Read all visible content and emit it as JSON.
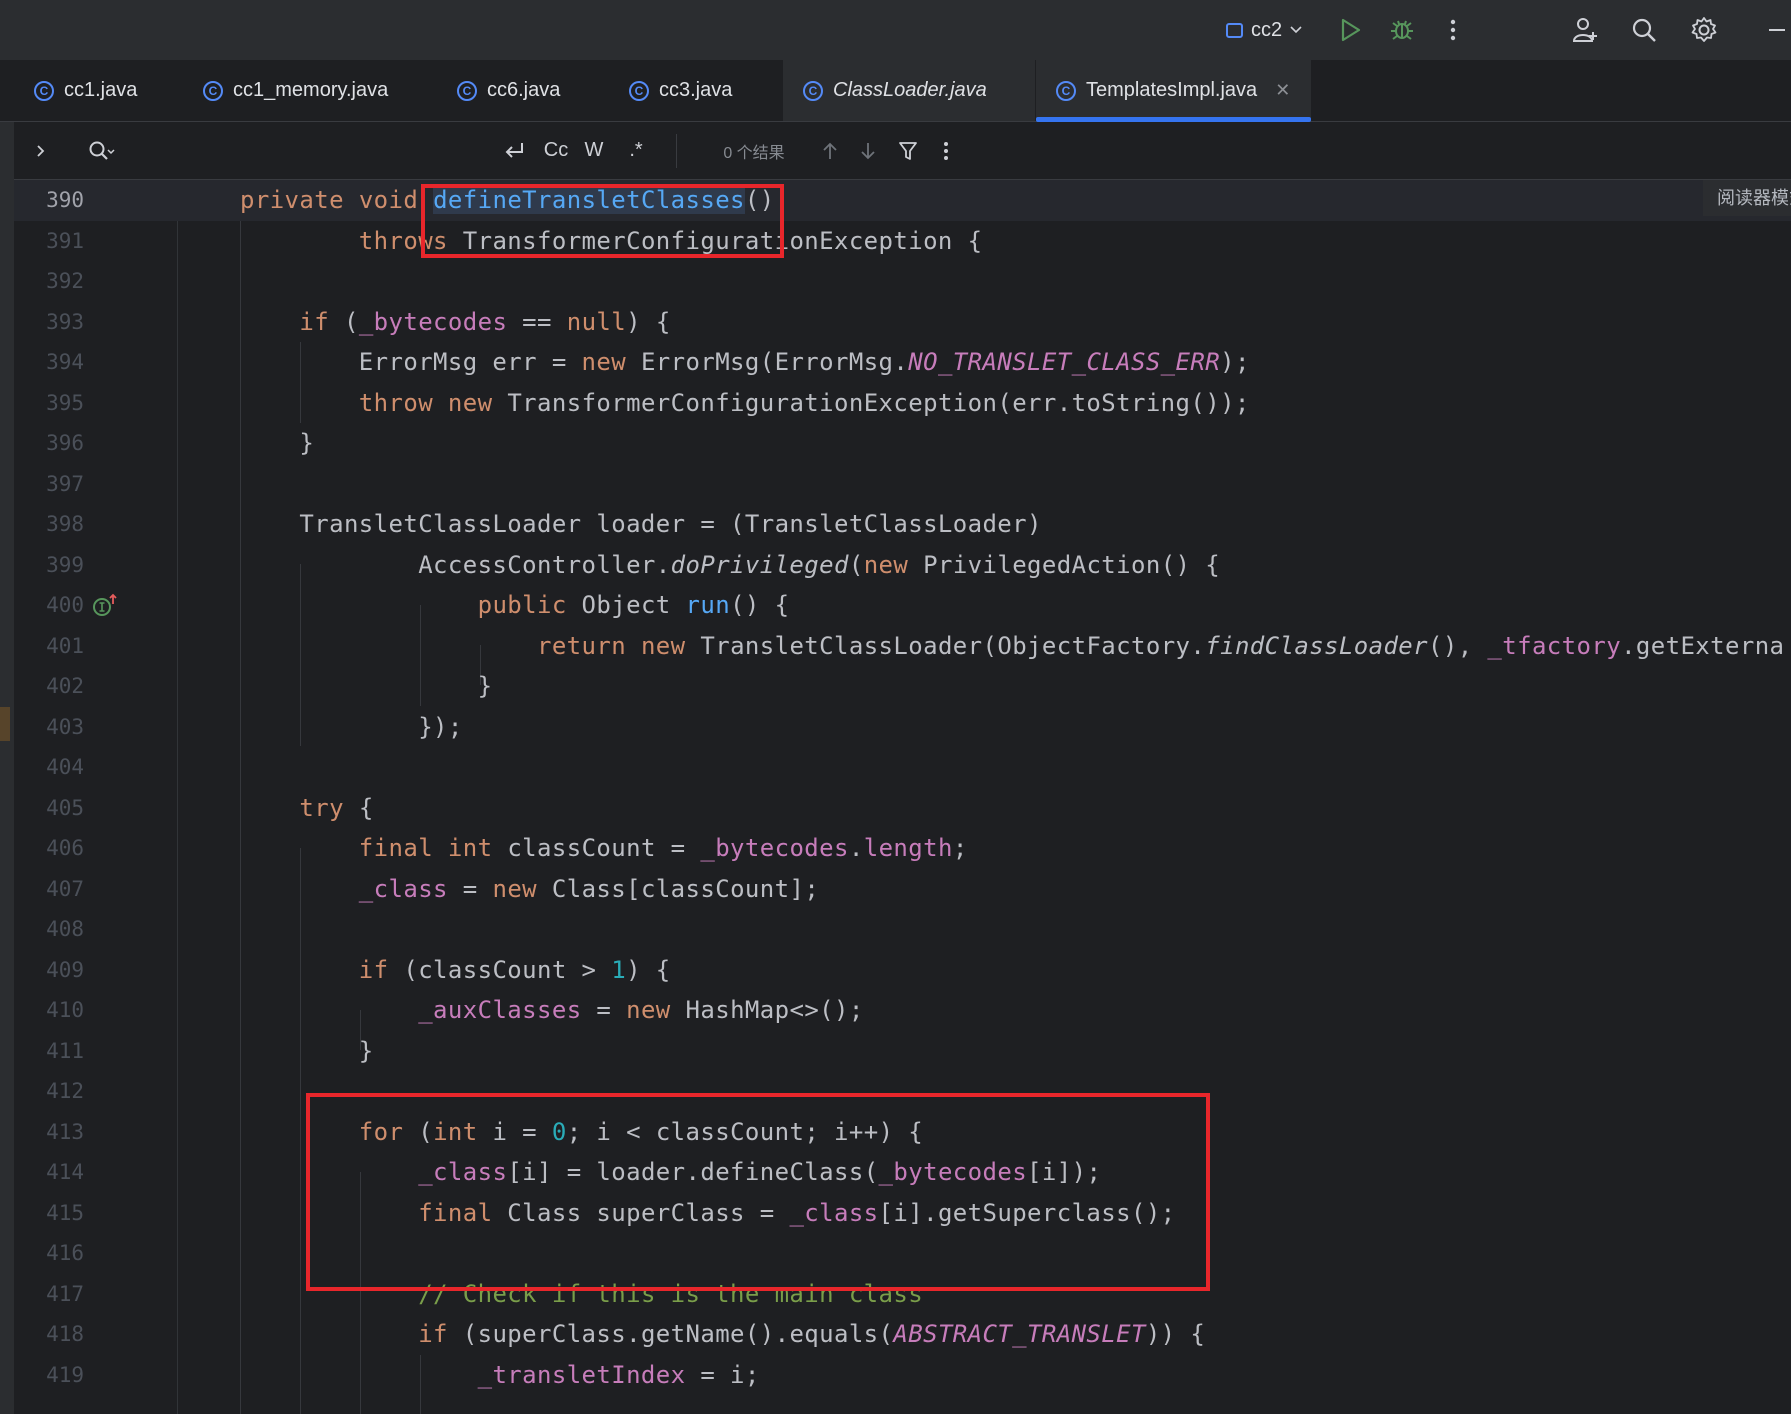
{
  "toolbar": {
    "run_config": "cc2",
    "icons": [
      "run-icon",
      "debug-icon",
      "more-icon",
      "add-user-icon",
      "search-icon",
      "settings-icon",
      "minimize-icon"
    ]
  },
  "tabs": [
    {
      "label": "cc1.java"
    },
    {
      "label": "cc1_memory.java"
    },
    {
      "label": "cc6.java"
    },
    {
      "label": "cc3.java"
    },
    {
      "label": "ClassLoader.java"
    },
    {
      "label": "TemplatesImpl.java",
      "active": true
    }
  ],
  "find_bar": {
    "match_case": "Cc",
    "words": "W",
    "regex": ".*",
    "result_count": "0 个结果"
  },
  "editor": {
    "reader_mode": "阅读器模式",
    "current_line": "390",
    "lines": [
      {
        "n": "390"
      },
      {
        "n": "391"
      },
      {
        "n": "392"
      },
      {
        "n": "393"
      },
      {
        "n": "394"
      },
      {
        "n": "395"
      },
      {
        "n": "396"
      },
      {
        "n": "397"
      },
      {
        "n": "398"
      },
      {
        "n": "399"
      },
      {
        "n": "400"
      },
      {
        "n": "401"
      },
      {
        "n": "402"
      },
      {
        "n": "403"
      },
      {
        "n": "404"
      },
      {
        "n": "405"
      },
      {
        "n": "406"
      },
      {
        "n": "407"
      },
      {
        "n": "408"
      },
      {
        "n": "409"
      },
      {
        "n": "410"
      },
      {
        "n": "411"
      },
      {
        "n": "412"
      },
      {
        "n": "413"
      },
      {
        "n": "414"
      },
      {
        "n": "415"
      },
      {
        "n": "416"
      },
      {
        "n": "417"
      },
      {
        "n": "418"
      },
      {
        "n": "419"
      }
    ]
  },
  "code": {
    "l390": {
      "t1": "private",
      "t2": " ",
      "t3": "void",
      "t4": " ",
      "t5": "defineTransletClasses",
      "t6": "()"
    },
    "l391": {
      "t1": "        ",
      "t2": "throws",
      "t3": " TransformerConfigurationException {"
    },
    "l393": {
      "t1": "    ",
      "t2": "if",
      "t3": " (",
      "t4": "_bytecodes",
      "t5": " == ",
      "t6": "null",
      "t7": ") {"
    },
    "l394": {
      "t1": "        ErrorMsg err = ",
      "t2": "new",
      "t3": " ErrorMsg(ErrorMsg.",
      "t4": "NO_TRANSLET_CLASS_ERR",
      "t5": ");"
    },
    "l395": {
      "t1": "        ",
      "t2": "throw",
      "t3": " ",
      "t4": "new",
      "t5": " TransformerConfigurationException(err.toString());"
    },
    "l396": {
      "t1": "    }"
    },
    "l398": {
      "t1": "    TransletClassLoader loader = (TransletClassLoader)"
    },
    "l399": {
      "t1": "            AccessController.",
      "t2": "doPrivileged",
      "t3": "(",
      "t4": "new",
      "t5": " PrivilegedAction() {"
    },
    "l400": {
      "t1": "                ",
      "t2": "public",
      "t3": " Object ",
      "t4": "run",
      "t5": "() {"
    },
    "l401": {
      "t1": "                    ",
      "t2": "return",
      "t3": " ",
      "t4": "new",
      "t5": " TransletClassLoader(ObjectFactory.",
      "t6": "findClassLoader",
      "t7": "(), ",
      "t8": "_tfactory",
      "t9": ".getExterna"
    },
    "l402": {
      "t1": "                }"
    },
    "l403": {
      "t1": "            });"
    },
    "l405": {
      "t1": "    ",
      "t2": "try",
      "t3": " {"
    },
    "l406": {
      "t1": "        ",
      "t2": "final",
      "t3": " ",
      "t4": "int",
      "t5": " classCount = ",
      "t6": "_bytecodes",
      "t7": ".",
      "t8": "length",
      "t9": ";"
    },
    "l407": {
      "t1": "        ",
      "t2": "_class",
      "t3": " = ",
      "t4": "new",
      "t5": " Class[classCount];"
    },
    "l409": {
      "t1": "        ",
      "t2": "if",
      "t3": " (classCount > ",
      "t4": "1",
      "t5": ") {"
    },
    "l410": {
      "t1": "            ",
      "t2": "_auxClasses",
      "t3": " = ",
      "t4": "new",
      "t5": " HashMap<>();"
    },
    "l411": {
      "t1": "        }"
    },
    "l413": {
      "t1": "        ",
      "t2": "for",
      "t3": " (",
      "t4": "int",
      "t5": " i = ",
      "t6": "0",
      "t7": "; i < classCount; i++) {"
    },
    "l414": {
      "t1": "            ",
      "t2": "_class",
      "t3": "[i] = loader.defineClass(",
      "t4": "_bytecodes",
      "t5": "[i]);"
    },
    "l415": {
      "t1": "            ",
      "t2": "final",
      "t3": " Class superClass = ",
      "t4": "_class",
      "t5": "[i].getSuperclass();"
    },
    "l417": {
      "t1": "            ",
      "t2": "// Check if this is the main class"
    },
    "l418": {
      "t1": "            ",
      "t2": "if",
      "t3": " (superClass.getName().equals(",
      "t4": "ABSTRACT_TRANSLET",
      "t5": ")) {"
    },
    "l419": {
      "t1": "                ",
      "t2": "_transletIndex",
      "t3": " = i;"
    }
  },
  "colors": {
    "accent": "#3574f0",
    "annotation": "#e8262b",
    "keyword": "#cf8e6d",
    "field": "#c77dbb",
    "method": "#56a8f5",
    "number": "#2aacb8",
    "comment": "#7a9e4a"
  }
}
